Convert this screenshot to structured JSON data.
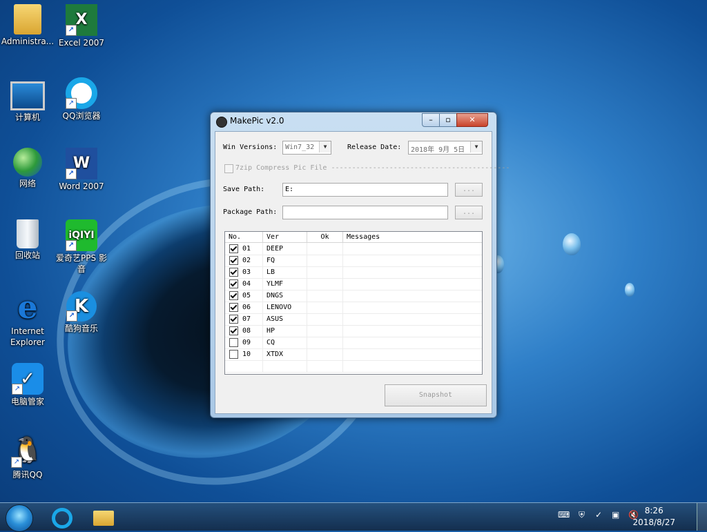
{
  "desktop": {
    "icons": [
      {
        "label": "Administra...",
        "glyph": "📁"
      },
      {
        "label": "Excel 2007",
        "glyph": "X"
      },
      {
        "label": "计算机",
        "glyph": "🖥"
      },
      {
        "label": "QQ浏览器",
        "glyph": "Q"
      },
      {
        "label": "网络",
        "glyph": "🌐"
      },
      {
        "label": "Word 2007",
        "glyph": "W"
      },
      {
        "label": "回收站",
        "glyph": "🗑"
      },
      {
        "label": "爱奇艺PPS 影音",
        "glyph": "iQIYI"
      },
      {
        "label": "Internet Explorer",
        "glyph": "e"
      },
      {
        "label": "酷狗音乐",
        "glyph": "K"
      },
      {
        "label": "电脑管家",
        "glyph": "✓"
      },
      {
        "label": "腾讯QQ",
        "glyph": "🐧"
      }
    ]
  },
  "window": {
    "title": "MakePic v2.0",
    "minimize_glyph": "–",
    "maximize_glyph": "▫",
    "close_glyph": "✕",
    "win_versions_label": "Win Versions:",
    "win_versions_value": "Win7_32",
    "release_date_label": "Release Date:",
    "release_date_value": "2018年 9月 5日",
    "compress_label": "7zip Compress Pic File",
    "compress_line": "-------------------------------------------",
    "save_path_label": "Save Path:",
    "save_path_value": "E:",
    "package_path_label": "Package Path:",
    "package_path_value": "",
    "browse_label": "...",
    "snapshot_label": "Snapshot",
    "list": {
      "columns": [
        "No.",
        "Ver",
        "Ok",
        "Messages"
      ],
      "rows": [
        {
          "no": "01",
          "ver": "DEEP",
          "checked": true
        },
        {
          "no": "02",
          "ver": "FQ",
          "checked": true
        },
        {
          "no": "03",
          "ver": "LB",
          "checked": true
        },
        {
          "no": "04",
          "ver": "YLMF",
          "checked": true
        },
        {
          "no": "05",
          "ver": "DNGS",
          "checked": true
        },
        {
          "no": "06",
          "ver": "LENOVO",
          "checked": true
        },
        {
          "no": "07",
          "ver": "ASUS",
          "checked": true
        },
        {
          "no": "08",
          "ver": "HP",
          "checked": true
        },
        {
          "no": "09",
          "ver": "CQ",
          "checked": false
        },
        {
          "no": "10",
          "ver": "XTDX",
          "checked": false
        }
      ]
    }
  },
  "taskbar": {
    "time": "8:26",
    "date": "2018/8/27"
  }
}
